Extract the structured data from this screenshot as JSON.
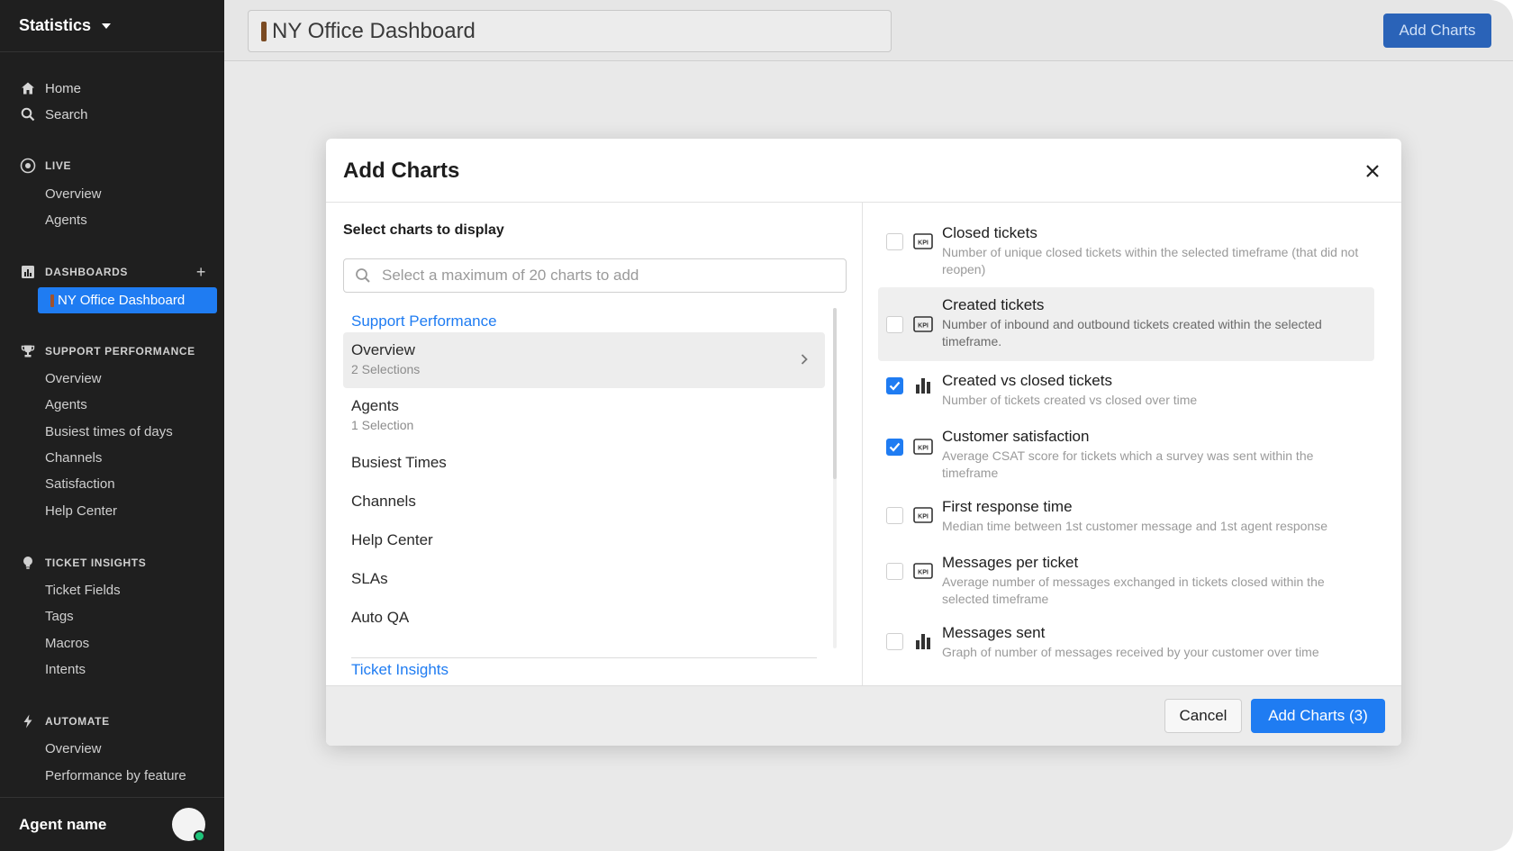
{
  "sidebar": {
    "title": "Statistics",
    "nav": [
      {
        "label": "Home",
        "icon": "home-icon"
      },
      {
        "label": "Search",
        "icon": "search-icon"
      }
    ],
    "live": {
      "label": "LIVE",
      "items": [
        "Overview",
        "Agents"
      ]
    },
    "dashboards": {
      "label": "DASHBOARDS",
      "active_item": "NY Office Dashboard"
    },
    "support_performance": {
      "label": "SUPPORT PERFORMANCE",
      "items": [
        "Overview",
        "Agents",
        "Busiest times of days",
        "Channels",
        "Satisfaction",
        "Help Center"
      ]
    },
    "ticket_insights": {
      "label": "TICKET INSIGHTS",
      "items": [
        "Ticket Fields",
        "Tags",
        "Macros",
        "Intents"
      ]
    },
    "automate": {
      "label": "AUTOMATE",
      "items": [
        "Overview",
        "Performance by feature"
      ]
    },
    "agent_name": "Agent name"
  },
  "header": {
    "dashboard_title": "NY Office Dashboard",
    "add_charts_label": "Add Charts"
  },
  "modal": {
    "title": "Add Charts",
    "select_label": "Select charts to display",
    "search_placeholder": "Select a maximum of 20 charts to add",
    "groups": [
      {
        "label": "Support Performance"
      },
      {
        "label": "Ticket Insights"
      }
    ],
    "categories": [
      {
        "label": "Overview",
        "sub": "2 Selections",
        "active": true
      },
      {
        "label": "Agents",
        "sub": "1 Selection"
      },
      {
        "label": "Busiest Times"
      },
      {
        "label": "Channels"
      },
      {
        "label": "Help Center"
      },
      {
        "label": "SLAs"
      },
      {
        "label": "Auto QA"
      }
    ],
    "charts": [
      {
        "title": "Closed tickets",
        "desc": "Number of unique closed tickets within the selected timeframe (that did not reopen)",
        "checked": false,
        "kind": "kpi-icon"
      },
      {
        "title": "Created tickets",
        "desc": "Number of inbound and outbound tickets created within the selected timeframe.",
        "checked": false,
        "kind": "kpi-icon",
        "highlight": true
      },
      {
        "title": "Created vs closed tickets",
        "desc": "Number of tickets created vs closed over time",
        "checked": true,
        "kind": "bar-chart-icon"
      },
      {
        "title": "Customer satisfaction",
        "desc": "Average CSAT score for tickets which a survey was sent within the timeframe",
        "checked": true,
        "kind": "kpi-icon"
      },
      {
        "title": "First response time",
        "desc": "Median time between 1st customer message and 1st agent response",
        "checked": false,
        "kind": "kpi-icon"
      },
      {
        "title": "Messages per ticket",
        "desc": "Average number of messages exchanged in tickets closed within the selected timeframe",
        "checked": false,
        "kind": "kpi-icon"
      },
      {
        "title": "Messages sent",
        "desc": "Graph of number of messages received by your customer over time",
        "checked": false,
        "kind": "bar-chart-icon"
      }
    ],
    "cancel_label": "Cancel",
    "add_label": "Add Charts (3)"
  },
  "colors": {
    "accent": "#1f7cf2",
    "sidebar_bg": "#1f1f1f",
    "online": "#1ec47a"
  }
}
